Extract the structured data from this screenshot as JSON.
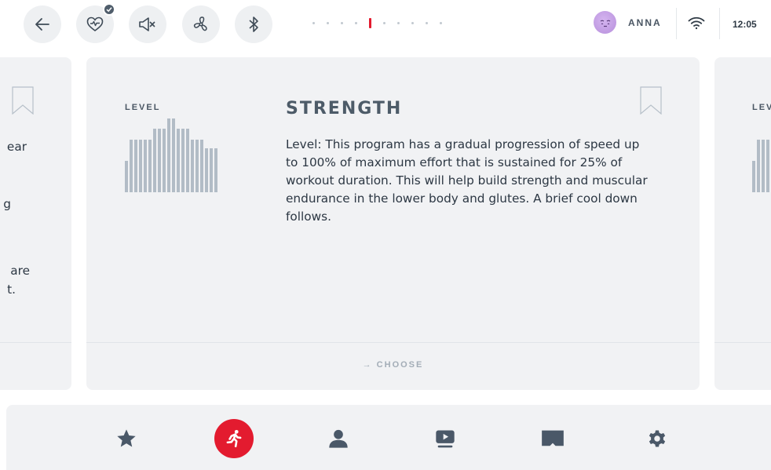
{
  "header": {
    "buttons": [
      {
        "name": "back-button",
        "icon": "back-arrow-icon"
      },
      {
        "name": "heart-rate-button",
        "icon": "heart-rate-icon",
        "badge": "check-badge-icon"
      },
      {
        "name": "mute-button",
        "icon": "speaker-muted-icon"
      },
      {
        "name": "fan-button",
        "icon": "fan-icon"
      },
      {
        "name": "bluetooth-button",
        "icon": "bluetooth-icon"
      }
    ],
    "pager": {
      "count": 10,
      "active_index": 4
    },
    "user": {
      "name": "ANNA",
      "avatar": "sleepy-face-avatar"
    },
    "wifi_icon": "wifi-icon",
    "time": "12:05"
  },
  "colors": {
    "accent": "#e31b2f",
    "card_bg": "#f1f2f4",
    "bar": "#b2bcc6",
    "title": "#4d5b68"
  },
  "cards": {
    "left": {
      "partial_lines": [
        "ear",
        "g",
        "are",
        "t."
      ]
    },
    "center": {
      "level_label": "LEVEL",
      "level_profile": [
        0.43,
        0.71,
        0.71,
        0.71,
        0.71,
        0.71,
        0.86,
        0.86,
        0.86,
        1.0,
        1.0,
        0.86,
        0.86,
        0.86,
        0.71,
        0.71,
        0.71,
        0.6,
        0.6,
        0.6
      ],
      "title": "STRENGTH",
      "description": "Level: This program has a gradual progression of speed up to 100% of maximum effort that is sustained for 25% of workout duration. This will help build strength and muscular endurance in the lower body and glutes. A brief cool down follows.",
      "choose_label": "→ CHOOSE"
    },
    "right": {
      "level_label": "LEV"
    }
  },
  "bottom_nav": {
    "items": [
      {
        "name": "favorites",
        "icon": "star-icon",
        "active": false
      },
      {
        "name": "workouts",
        "icon": "running-person-icon",
        "active": true
      },
      {
        "name": "trainer",
        "icon": "person-icon",
        "active": false
      },
      {
        "name": "video",
        "icon": "play-screen-icon",
        "active": false
      },
      {
        "name": "scenery",
        "icon": "landscape-icon",
        "active": false
      },
      {
        "name": "settings",
        "icon": "gear-icon",
        "active": false
      }
    ]
  }
}
